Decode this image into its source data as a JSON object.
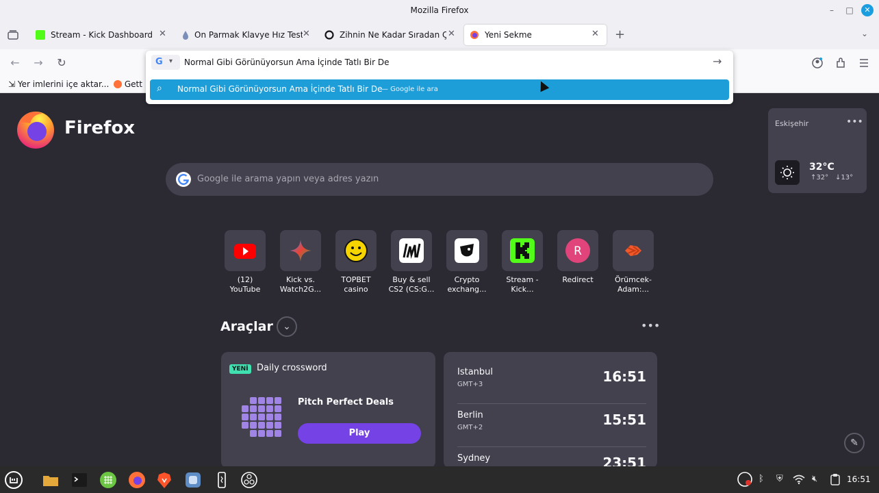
{
  "window": {
    "title": "Mozilla Firefox"
  },
  "tabs": [
    {
      "label": "Stream - Kick Dashboard",
      "favicon": "kick-icon",
      "active": false
    },
    {
      "label": "On Parmak Klavye Hız Testi |",
      "favicon": "droplet-icon",
      "active": false
    },
    {
      "label": "Zihnin Ne Kadar Sıradan Çalı",
      "favicon": "chat-icon",
      "active": false
    },
    {
      "label": "Yeni Sekme",
      "favicon": "firefox-icon",
      "active": true
    }
  ],
  "urlbar": {
    "value": "Normal Gibi Görünüyorsun Ama İçinde Tatlı Bir De",
    "engine": "G",
    "suggestion": "Normal Gibi Görünüyorsun Ama İçinde Tatlı Bir De",
    "suggestion_action": "— Google ile ara"
  },
  "bookmarks": [
    {
      "label": "Yer imlerini içe aktar..."
    },
    {
      "label": "Gett"
    }
  ],
  "newtab": {
    "brand": "Firefox",
    "search_placeholder": "Google ile arama yapın veya adres yazın",
    "weather": {
      "city": "Eskişehir",
      "temp": "32°C",
      "high": "↑32°",
      "low": "↓13°"
    },
    "shortcuts": [
      {
        "label": "(12)\nYouTube",
        "icon": "youtube-icon",
        "color": "#ff0000"
      },
      {
        "label": "Kick vs.\nWatch2G...",
        "icon": "gemini-star-icon",
        "color": "#4b8df8"
      },
      {
        "label": "TOPBET\ncasino",
        "icon": "smiley-icon",
        "color": "#f5d400"
      },
      {
        "label": "Buy & sell\nCS2 (CS:G...",
        "icon": "lm-logo-icon",
        "color": "#ffffff"
      },
      {
        "label": "Crypto\nexchang...",
        "icon": "crypto-logo-icon",
        "color": "#ffffff"
      },
      {
        "label": "Stream -\nKick...",
        "icon": "kick-icon",
        "color": "#53fc18"
      },
      {
        "label": "Redirect",
        "icon": "letter-r-icon",
        "color": "#e0447a"
      },
      {
        "label": "Örümcek-\nAdam:...",
        "icon": "spider-icon",
        "color": "#f0592a"
      }
    ],
    "tools": {
      "title": "Araçlar",
      "crossword": {
        "badge": "YENİ",
        "title": "Daily crossword",
        "deal": "Pitch Perfect Deals",
        "play": "Play"
      },
      "clocks": [
        {
          "city": "Istanbul",
          "tz": "GMT+3",
          "time": "16:51"
        },
        {
          "city": "Berlin",
          "tz": "GMT+2",
          "time": "15:51"
        },
        {
          "city": "Sydney",
          "tz": "",
          "time": "23:51"
        }
      ]
    }
  },
  "taskbar": {
    "clock": "16:51"
  }
}
